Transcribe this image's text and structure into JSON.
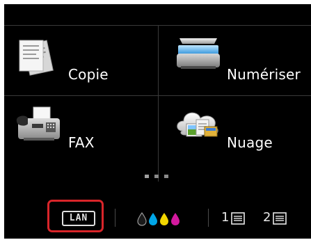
{
  "menu": {
    "tiles": [
      {
        "label": "Copie",
        "icon": "copy-icon"
      },
      {
        "label": "Numériser",
        "icon": "scan-icon"
      },
      {
        "label": "FAX",
        "icon": "fax-icon"
      },
      {
        "label": "Nuage",
        "icon": "cloud-icon"
      }
    ],
    "page_indicator": {
      "pages": 3
    }
  },
  "status_bar": {
    "network": {
      "label": "LAN",
      "icon": "lan-icon",
      "highlighted": true
    },
    "ink": {
      "icon": "ink-level-icon",
      "colors": [
        "#1a1a1a",
        "#00a6e8",
        "#f2d600",
        "#d4199e"
      ]
    },
    "trays": [
      {
        "label": "1",
        "icon": "paper-tray-icon"
      },
      {
        "label": "2",
        "icon": "paper-tray-icon"
      }
    ]
  },
  "colors": {
    "screen_bg": "#000000",
    "highlight": "#d9252a"
  }
}
